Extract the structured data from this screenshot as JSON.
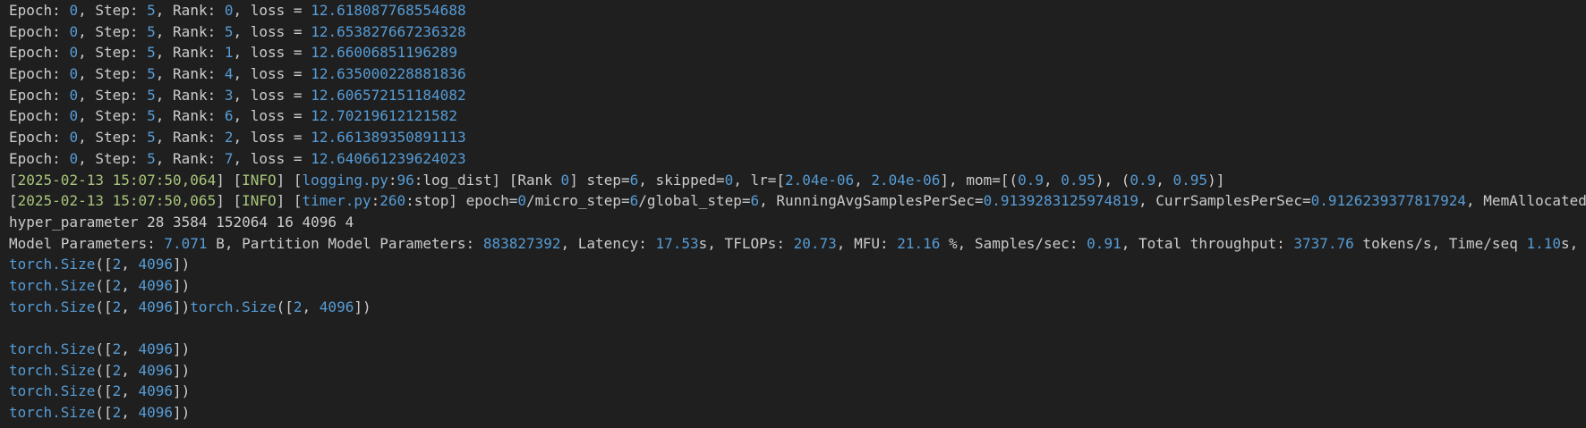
{
  "colors": {
    "background": "#1f1f1f",
    "text": "#cccccc",
    "number": "#569cd6",
    "info_green": "#a9c57b"
  },
  "lines": [
    [
      {
        "t": "Epoch: "
      },
      {
        "t": "0",
        "c": "num"
      },
      {
        "t": ", Step: "
      },
      {
        "t": "5",
        "c": "num"
      },
      {
        "t": ", Rank: "
      },
      {
        "t": "0",
        "c": "num"
      },
      {
        "t": ", loss = "
      },
      {
        "t": "12.618087768554688",
        "c": "num"
      }
    ],
    [
      {
        "t": "Epoch: "
      },
      {
        "t": "0",
        "c": "num"
      },
      {
        "t": ", Step: "
      },
      {
        "t": "5",
        "c": "num"
      },
      {
        "t": ", Rank: "
      },
      {
        "t": "5",
        "c": "num"
      },
      {
        "t": ", loss = "
      },
      {
        "t": "12.653827667236328",
        "c": "num"
      }
    ],
    [
      {
        "t": "Epoch: "
      },
      {
        "t": "0",
        "c": "num"
      },
      {
        "t": ", Step: "
      },
      {
        "t": "5",
        "c": "num"
      },
      {
        "t": ", Rank: "
      },
      {
        "t": "1",
        "c": "num"
      },
      {
        "t": ", loss = "
      },
      {
        "t": "12.66006851196289",
        "c": "num"
      }
    ],
    [
      {
        "t": "Epoch: "
      },
      {
        "t": "0",
        "c": "num"
      },
      {
        "t": ", Step: "
      },
      {
        "t": "5",
        "c": "num"
      },
      {
        "t": ", Rank: "
      },
      {
        "t": "4",
        "c": "num"
      },
      {
        "t": ", loss = "
      },
      {
        "t": "12.635000228881836",
        "c": "num"
      }
    ],
    [
      {
        "t": "Epoch: "
      },
      {
        "t": "0",
        "c": "num"
      },
      {
        "t": ", Step: "
      },
      {
        "t": "5",
        "c": "num"
      },
      {
        "t": ", Rank: "
      },
      {
        "t": "3",
        "c": "num"
      },
      {
        "t": ", loss = "
      },
      {
        "t": "12.606572151184082",
        "c": "num"
      }
    ],
    [
      {
        "t": "Epoch: "
      },
      {
        "t": "0",
        "c": "num"
      },
      {
        "t": ", Step: "
      },
      {
        "t": "5",
        "c": "num"
      },
      {
        "t": ", Rank: "
      },
      {
        "t": "6",
        "c": "num"
      },
      {
        "t": ", loss = "
      },
      {
        "t": "12.70219612121582",
        "c": "num"
      }
    ],
    [
      {
        "t": "Epoch: "
      },
      {
        "t": "0",
        "c": "num"
      },
      {
        "t": ", Step: "
      },
      {
        "t": "5",
        "c": "num"
      },
      {
        "t": ", Rank: "
      },
      {
        "t": "2",
        "c": "num"
      },
      {
        "t": ", loss = "
      },
      {
        "t": "12.661389350891113",
        "c": "num"
      }
    ],
    [
      {
        "t": "Epoch: "
      },
      {
        "t": "0",
        "c": "num"
      },
      {
        "t": ", Step: "
      },
      {
        "t": "5",
        "c": "num"
      },
      {
        "t": ", Rank: "
      },
      {
        "t": "7",
        "c": "num"
      },
      {
        "t": ", loss = "
      },
      {
        "t": "12.640661239624023",
        "c": "num"
      }
    ],
    [
      {
        "t": "["
      },
      {
        "t": "2025-02-13 15:07:50,064",
        "c": "green"
      },
      {
        "t": "] ["
      },
      {
        "t": "INFO",
        "c": "green"
      },
      {
        "t": "] ["
      },
      {
        "t": "logging.py",
        "c": "num"
      },
      {
        "t": ":"
      },
      {
        "t": "96",
        "c": "num"
      },
      {
        "t": ":log_dist] [Rank "
      },
      {
        "t": "0",
        "c": "num"
      },
      {
        "t": "] step="
      },
      {
        "t": "6",
        "c": "num"
      },
      {
        "t": ", skipped="
      },
      {
        "t": "0",
        "c": "num"
      },
      {
        "t": ", lr=["
      },
      {
        "t": "2.04e-06",
        "c": "num"
      },
      {
        "t": ", "
      },
      {
        "t": "2.04e-06",
        "c": "num"
      },
      {
        "t": "], mom=[("
      },
      {
        "t": "0.9",
        "c": "num"
      },
      {
        "t": ", "
      },
      {
        "t": "0.95",
        "c": "num"
      },
      {
        "t": "), ("
      },
      {
        "t": "0.9",
        "c": "num"
      },
      {
        "t": ", "
      },
      {
        "t": "0.95",
        "c": "num"
      },
      {
        "t": ")]"
      }
    ],
    [
      {
        "t": "["
      },
      {
        "t": "2025-02-13 15:07:50,065",
        "c": "green"
      },
      {
        "t": "] ["
      },
      {
        "t": "INFO",
        "c": "green"
      },
      {
        "t": "] ["
      },
      {
        "t": "timer.py",
        "c": "num"
      },
      {
        "t": ":"
      },
      {
        "t": "260",
        "c": "num"
      },
      {
        "t": ":stop] epoch="
      },
      {
        "t": "0",
        "c": "num"
      },
      {
        "t": "/micro_step="
      },
      {
        "t": "6",
        "c": "num"
      },
      {
        "t": "/global_step="
      },
      {
        "t": "6",
        "c": "num"
      },
      {
        "t": ", RunningAvgSamplesPerSec="
      },
      {
        "t": "0.9139283125974819",
        "c": "num"
      },
      {
        "t": ", CurrSamplesPerSec="
      },
      {
        "t": "0.9126239377817924",
        "c": "num"
      },
      {
        "t": ", MemAllocated"
      }
    ],
    [
      {
        "t": "hyper_parameter 28 3584 152064 16 4096 4"
      }
    ],
    [
      {
        "t": "Model Parameters: "
      },
      {
        "t": "7.071",
        "c": "num"
      },
      {
        "t": " B, Partition Model Parameters: "
      },
      {
        "t": "883827392",
        "c": "num"
      },
      {
        "t": ", Latency: "
      },
      {
        "t": "17.53",
        "c": "num"
      },
      {
        "t": "s, TFLOPs: "
      },
      {
        "t": "20.73",
        "c": "num"
      },
      {
        "t": ", MFU: "
      },
      {
        "t": "21.16",
        "c": "num"
      },
      {
        "t": " %, Samples/sec: "
      },
      {
        "t": "0.91",
        "c": "num"
      },
      {
        "t": ", Total throughput: "
      },
      {
        "t": "3737.76",
        "c": "num"
      },
      {
        "t": " tokens/s, Time/seq "
      },
      {
        "t": "1.10",
        "c": "num"
      },
      {
        "t": "s,"
      }
    ],
    [
      {
        "t": "torch.Size",
        "c": "fn"
      },
      {
        "t": "(["
      },
      {
        "t": "2",
        "c": "num"
      },
      {
        "t": ", "
      },
      {
        "t": "4096",
        "c": "num"
      },
      {
        "t": "])"
      }
    ],
    [
      {
        "t": "torch.Size",
        "c": "fn"
      },
      {
        "t": "(["
      },
      {
        "t": "2",
        "c": "num"
      },
      {
        "t": ", "
      },
      {
        "t": "4096",
        "c": "num"
      },
      {
        "t": "])"
      }
    ],
    [
      {
        "t": "torch.Size",
        "c": "fn"
      },
      {
        "t": "(["
      },
      {
        "t": "2",
        "c": "num"
      },
      {
        "t": ", "
      },
      {
        "t": "4096",
        "c": "num"
      },
      {
        "t": "])"
      },
      {
        "t": "torch.Size",
        "c": "fn"
      },
      {
        "t": "(["
      },
      {
        "t": "2",
        "c": "num"
      },
      {
        "t": ", "
      },
      {
        "t": "4096",
        "c": "num"
      },
      {
        "t": "])"
      }
    ],
    [],
    [
      {
        "t": "torch.Size",
        "c": "fn"
      },
      {
        "t": "(["
      },
      {
        "t": "2",
        "c": "num"
      },
      {
        "t": ", "
      },
      {
        "t": "4096",
        "c": "num"
      },
      {
        "t": "])"
      }
    ],
    [
      {
        "t": "torch.Size",
        "c": "fn"
      },
      {
        "t": "(["
      },
      {
        "t": "2",
        "c": "num"
      },
      {
        "t": ", "
      },
      {
        "t": "4096",
        "c": "num"
      },
      {
        "t": "])"
      }
    ],
    [
      {
        "t": "torch.Size",
        "c": "fn"
      },
      {
        "t": "(["
      },
      {
        "t": "2",
        "c": "num"
      },
      {
        "t": ", "
      },
      {
        "t": "4096",
        "c": "num"
      },
      {
        "t": "])"
      }
    ],
    [
      {
        "t": "torch.Size",
        "c": "fn"
      },
      {
        "t": "(["
      },
      {
        "t": "2",
        "c": "num"
      },
      {
        "t": ", "
      },
      {
        "t": "4096",
        "c": "num"
      },
      {
        "t": "])"
      }
    ]
  ]
}
